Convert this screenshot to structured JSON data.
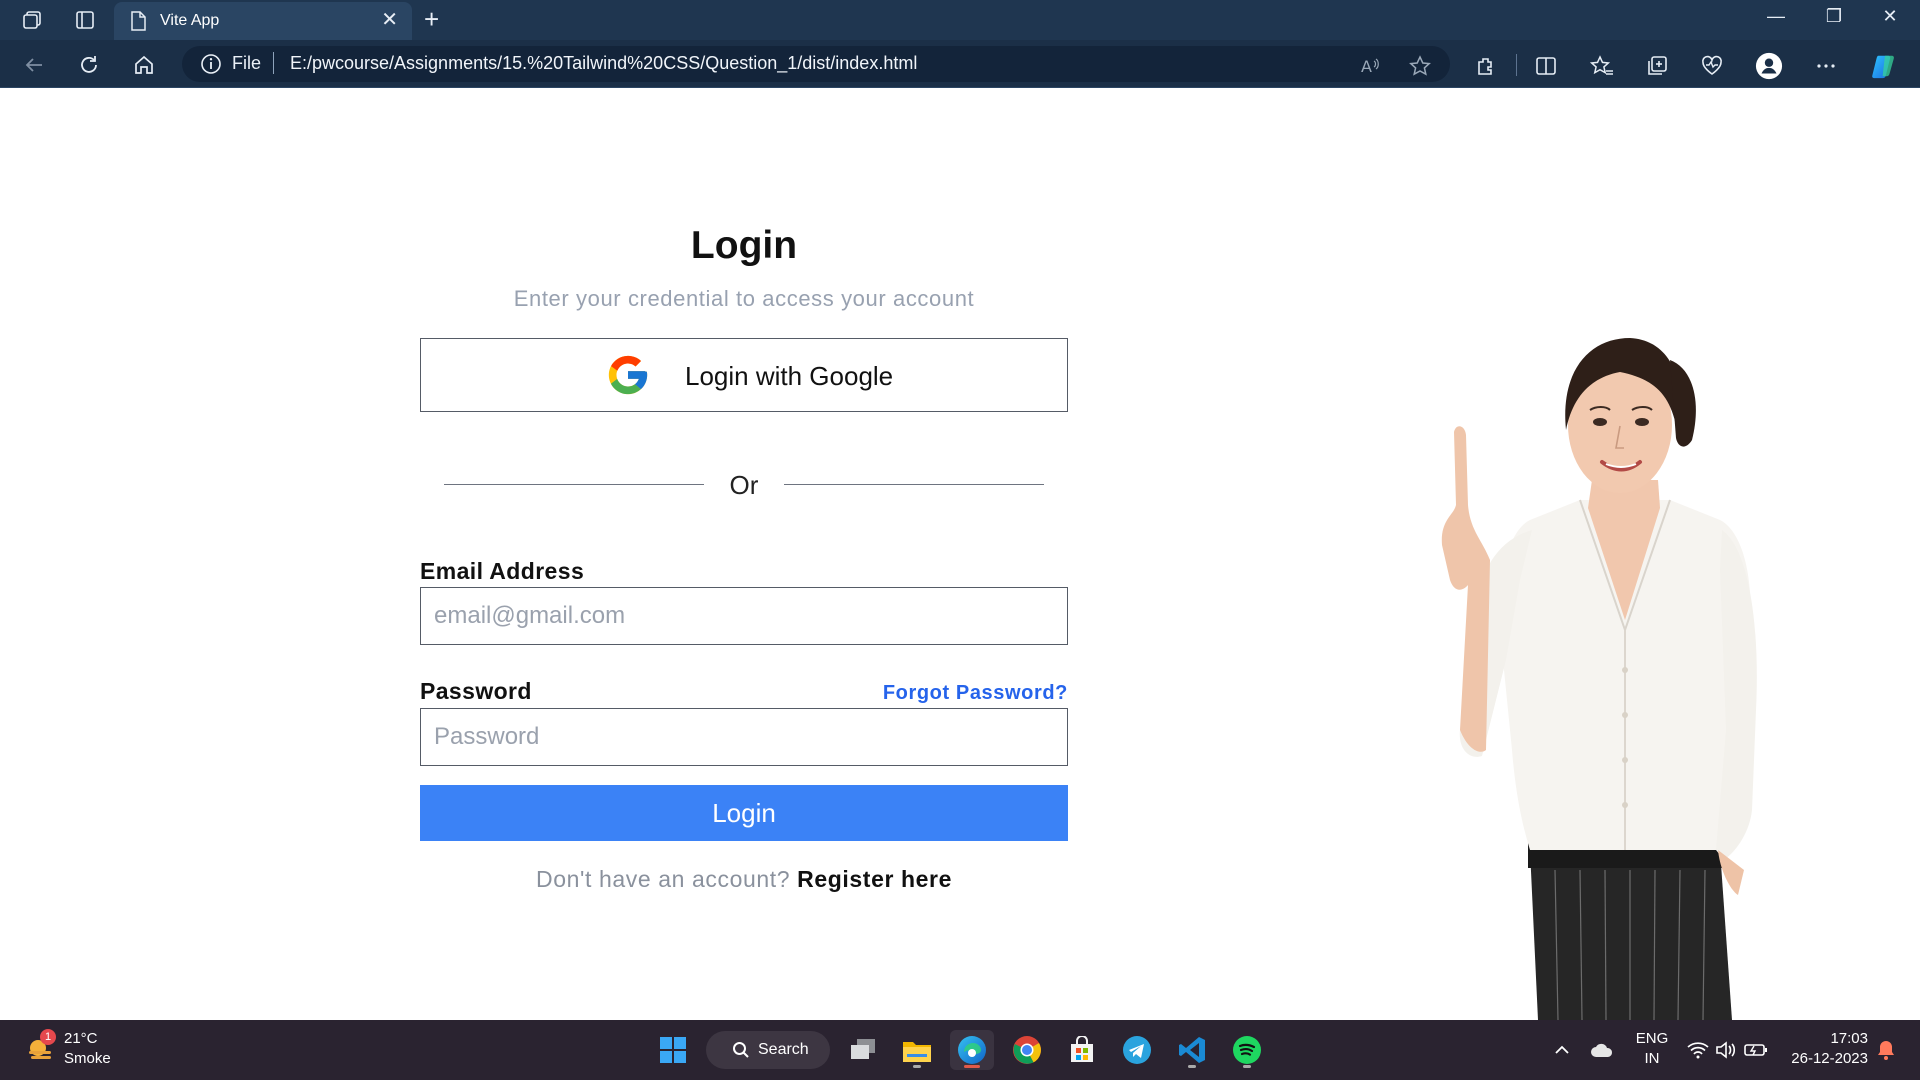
{
  "browser": {
    "tab_title": "Vite App",
    "url_scheme_label": "File",
    "url": "E:/pwcourse/Assignments/15.%20Tailwind%20CSS/Question_1/dist/index.html",
    "new_tab_symbol": "+",
    "close_tab_symbol": "✕",
    "window_controls": {
      "minimize": "—",
      "restore": "❐",
      "close": "✕"
    },
    "icons": [
      "workspaces-icon",
      "tab-actions-icon",
      "back-icon",
      "refresh-icon",
      "home-icon",
      "info-icon",
      "read-aloud-icon",
      "favorite-star-icon",
      "extensions-icon",
      "split-screen-icon",
      "favorites-icon",
      "collections-icon",
      "browser-essentials-icon",
      "profile-icon",
      "more-icon",
      "copilot-icon"
    ]
  },
  "login": {
    "title": "Login",
    "subtitle": "Enter your credential to access your account",
    "google_button_label": "Login with Google",
    "divider_text": "Or",
    "email_label": "Email Address",
    "email_placeholder": "email@gmail.com",
    "password_label": "Password",
    "forgot_password": "Forgot Password?",
    "password_placeholder": "Password",
    "submit_label": "Login",
    "register_prompt": "Don't have an account?",
    "register_link": "Register here"
  },
  "colors": {
    "primary_button": "#3b82f6",
    "link": "#2563eb",
    "subtitle": "#98a1b0",
    "browser_chrome": "#1f3650"
  },
  "taskbar": {
    "weather": {
      "badge": "1",
      "temp": "21°C",
      "desc": "Smoke"
    },
    "search_label": "Search",
    "apps": [
      "windows-start-icon",
      "task-view-icon",
      "file-explorer-icon",
      "edge-icon",
      "chrome-icon",
      "microsoft-store-icon",
      "telegram-icon",
      "vscode-icon",
      "spotify-icon"
    ],
    "tray": {
      "language": "ENG",
      "region": "IN",
      "time": "17:03",
      "date": "26-12-2023"
    }
  }
}
